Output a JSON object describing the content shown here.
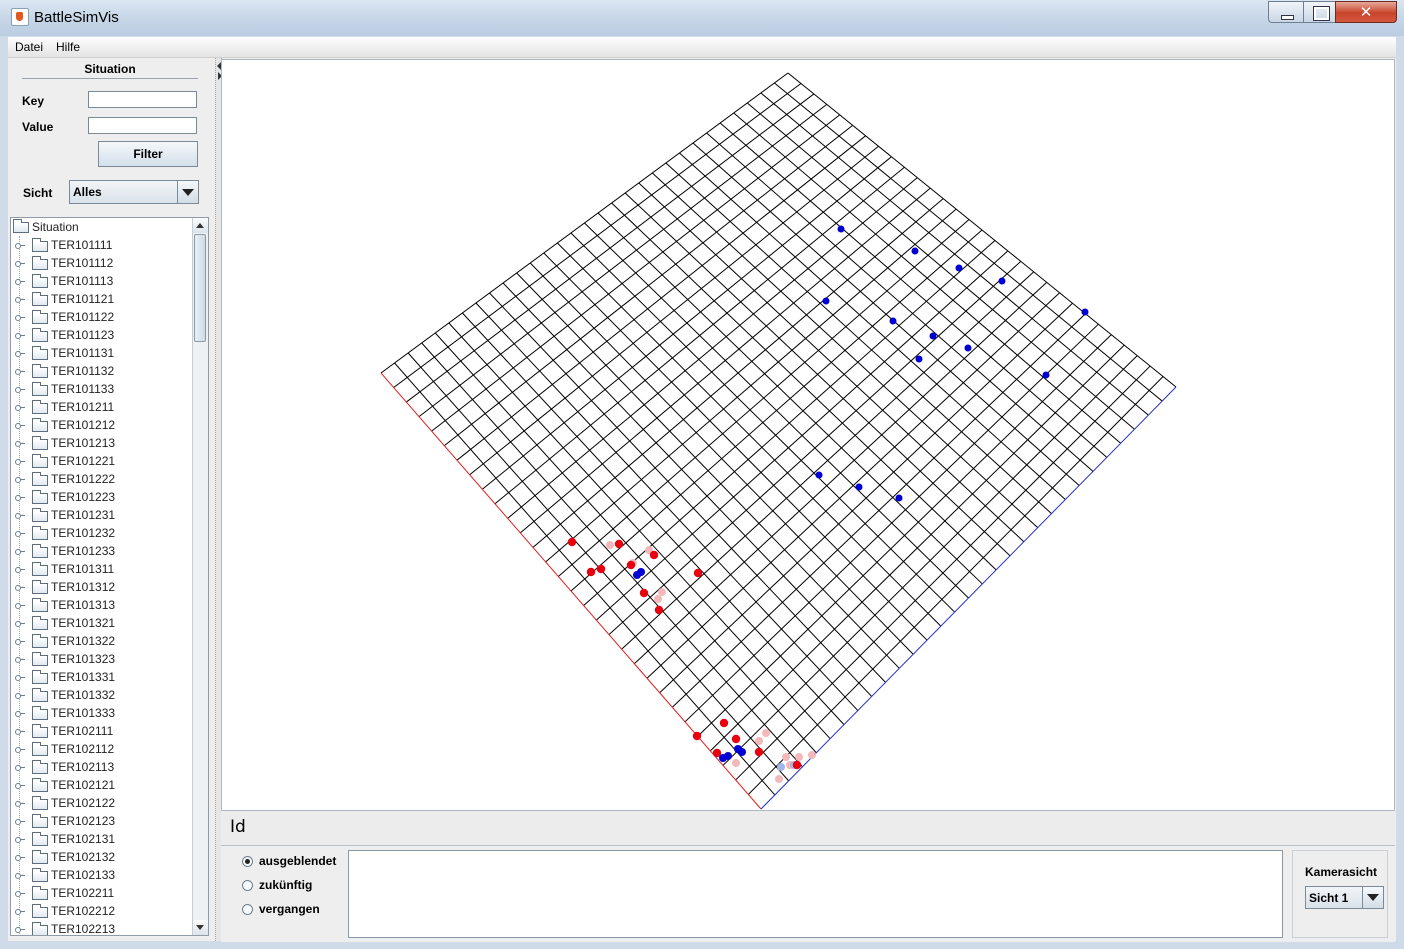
{
  "window": {
    "title": "BattleSimVis",
    "close_glyph": "✕"
  },
  "menu": [
    "Datei",
    "Hilfe"
  ],
  "situation_panel": {
    "title": "Situation",
    "key_label": "Key",
    "key_value": "",
    "value_label": "Value",
    "value_value": "",
    "filter_button": "Filter",
    "view_label": "Sicht",
    "view_selected": "Alles"
  },
  "tree": {
    "root": "Situation",
    "items": [
      "TER101111",
      "TER101112",
      "TER101113",
      "TER101121",
      "TER101122",
      "TER101123",
      "TER101131",
      "TER101132",
      "TER101133",
      "TER101211",
      "TER101212",
      "TER101213",
      "TER101221",
      "TER101222",
      "TER101223",
      "TER101231",
      "TER101232",
      "TER101233",
      "TER101311",
      "TER101312",
      "TER101313",
      "TER101321",
      "TER101322",
      "TER101323",
      "TER101331",
      "TER101332",
      "TER101333",
      "TER102111",
      "TER102112",
      "TER102113",
      "TER102121",
      "TER102122",
      "TER102123",
      "TER102131",
      "TER102132",
      "TER102133",
      "TER102211",
      "TER102212",
      "TER102213"
    ]
  },
  "id_label": "Id",
  "time_filter": {
    "options": [
      "ausgeblendet",
      "zukünftig",
      "vergangen"
    ],
    "selected": "ausgeblendet"
  },
  "camera": {
    "title": "Kamerasicht",
    "selected": "Sicht 1"
  },
  "colors": {
    "red_units": "#e8000e",
    "blue_units": "#0000d4",
    "ghost_red": "#f4b8bb",
    "ghost_blue": "#9fb6e6",
    "axis_x": "#e02020",
    "axis_y": "#2030c0"
  },
  "icons": [
    "java-cup-icon",
    "minimize-icon",
    "maximize-icon",
    "close-icon",
    "folder-icon",
    "chevron-down-icon"
  ]
}
